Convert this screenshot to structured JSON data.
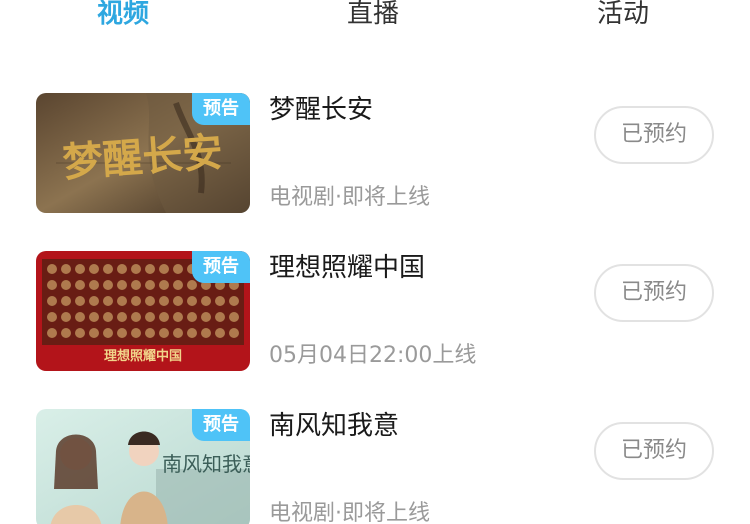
{
  "tabs": [
    {
      "label": "视频",
      "active": true
    },
    {
      "label": "直播",
      "active": false
    },
    {
      "label": "活动",
      "active": false
    }
  ],
  "items": [
    {
      "title": "梦醒长安",
      "badge": "预告",
      "meta": "电视剧·即将上线",
      "button": "已预约",
      "poster_text": "梦醒长安"
    },
    {
      "title": "理想照耀中国",
      "badge": "预告",
      "meta": "05月04日22:00上线",
      "button": "已预约",
      "poster_text": "理想照耀中国"
    },
    {
      "title": "南风知我意",
      "badge": "预告",
      "meta": "电视剧·即将上线",
      "button": "已预约",
      "poster_text": "南风知我意"
    }
  ],
  "colors": {
    "accent": "#2ea7e0",
    "badge": "#4fc3f7",
    "meta_text": "#9a9a9a",
    "button_border": "#e2e2e2"
  }
}
